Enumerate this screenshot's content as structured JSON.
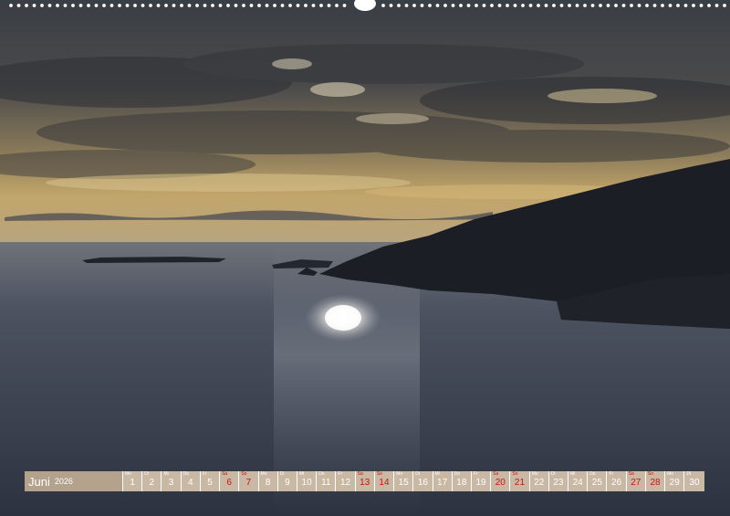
{
  "calendar": {
    "month": "Juni",
    "year": "2026",
    "weekend_color": "#c8140f",
    "days": [
      {
        "d": "1",
        "wd": "Mo",
        "we": false
      },
      {
        "d": "2",
        "wd": "Di",
        "we": false
      },
      {
        "d": "3",
        "wd": "Mi",
        "we": false
      },
      {
        "d": "4",
        "wd": "Do",
        "we": false
      },
      {
        "d": "5",
        "wd": "Fr",
        "we": false
      },
      {
        "d": "6",
        "wd": "Sa",
        "we": true
      },
      {
        "d": "7",
        "wd": "So",
        "we": true
      },
      {
        "d": "8",
        "wd": "Mo",
        "we": false
      },
      {
        "d": "9",
        "wd": "Di",
        "we": false
      },
      {
        "d": "10",
        "wd": "Mi",
        "we": false
      },
      {
        "d": "11",
        "wd": "Do",
        "we": false
      },
      {
        "d": "12",
        "wd": "Fr",
        "we": false
      },
      {
        "d": "13",
        "wd": "Sa",
        "we": true
      },
      {
        "d": "14",
        "wd": "So",
        "we": true
      },
      {
        "d": "15",
        "wd": "Mo",
        "we": false
      },
      {
        "d": "16",
        "wd": "Di",
        "we": false
      },
      {
        "d": "17",
        "wd": "Mi",
        "we": false
      },
      {
        "d": "18",
        "wd": "Do",
        "we": false
      },
      {
        "d": "19",
        "wd": "Fr",
        "we": false
      },
      {
        "d": "20",
        "wd": "Sa",
        "we": true
      },
      {
        "d": "21",
        "wd": "So",
        "we": true
      },
      {
        "d": "22",
        "wd": "Mo",
        "we": false
      },
      {
        "d": "23",
        "wd": "Di",
        "we": false
      },
      {
        "d": "24",
        "wd": "Mi",
        "we": false
      },
      {
        "d": "25",
        "wd": "Do",
        "we": false
      },
      {
        "d": "26",
        "wd": "Fr",
        "we": false
      },
      {
        "d": "27",
        "wd": "Sa",
        "we": true
      },
      {
        "d": "28",
        "wd": "So",
        "we": true
      },
      {
        "d": "29",
        "wd": "Mo",
        "we": false
      },
      {
        "d": "30",
        "wd": "Di",
        "we": false
      }
    ]
  }
}
